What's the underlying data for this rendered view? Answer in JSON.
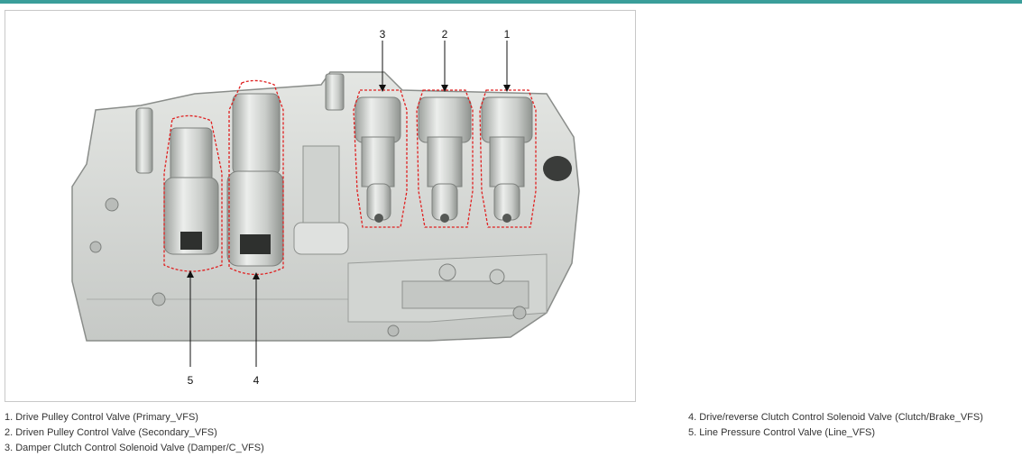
{
  "figure": {
    "callouts": [
      "1",
      "2",
      "3",
      "4",
      "5"
    ]
  },
  "legend": {
    "left": [
      "1. Drive Pulley Control Valve (Primary_VFS)",
      "2. Driven Pulley Control Valve (Secondary_VFS)",
      "3. Damper Clutch Control Solenoid Valve (Damper/C_VFS)"
    ],
    "right": [
      "4. Drive/reverse Clutch Control Solenoid Valve (Clutch/Brake_VFS)",
      "5. Line Pressure Control Valve (Line_VFS)"
    ]
  },
  "colors": {
    "accent_bar": "#3a9e9a",
    "highlight_outline": "#e02020",
    "body_fill": "#d9dcd9"
  }
}
